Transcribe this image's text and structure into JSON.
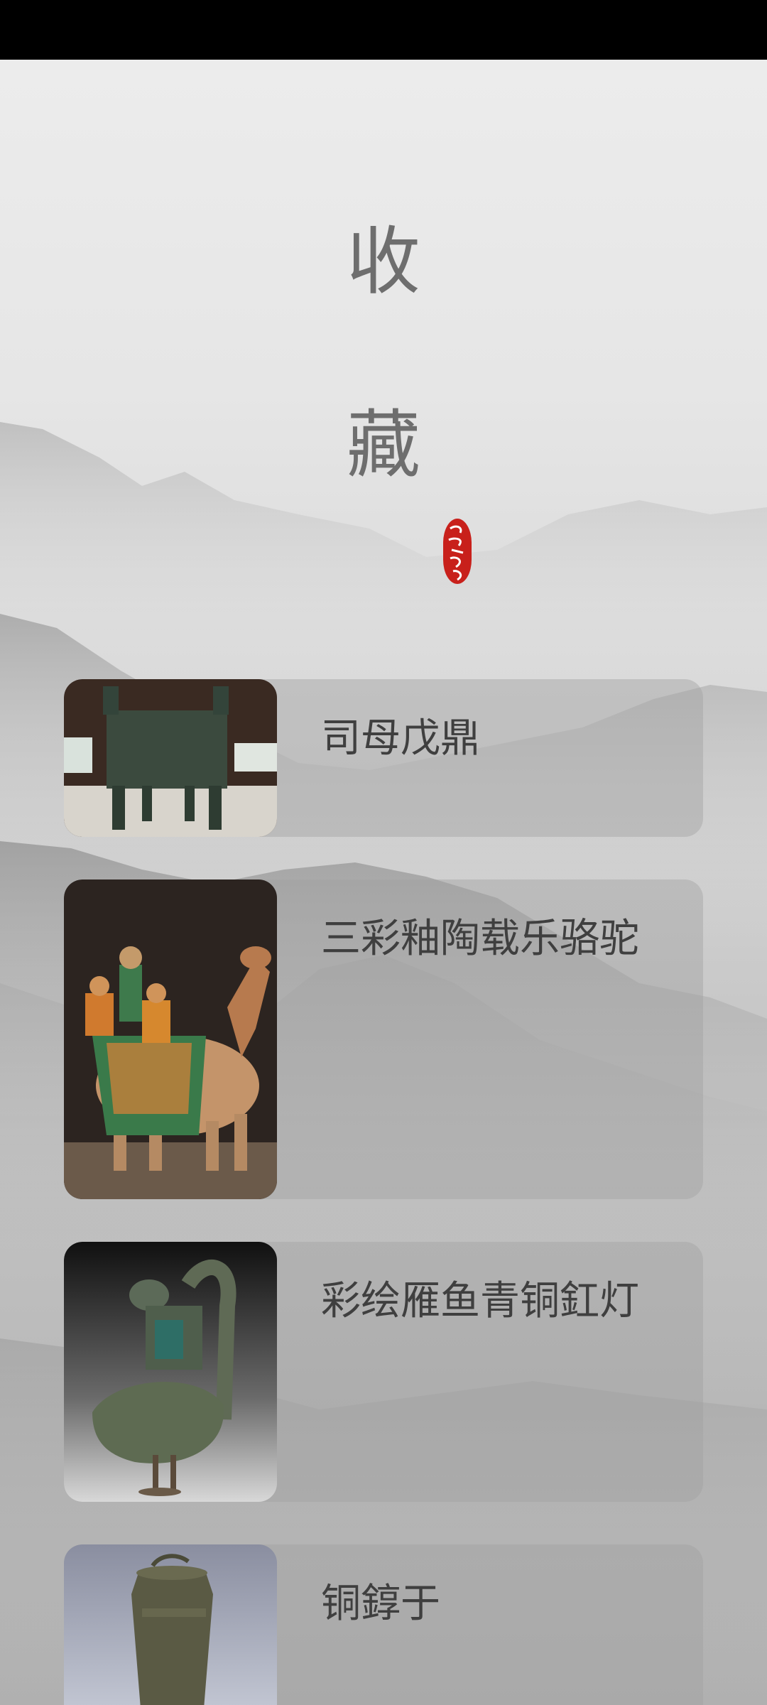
{
  "header": {
    "title_line1": "收",
    "title_line2": "藏"
  },
  "collection": {
    "items": [
      {
        "title": "司母戊鼎",
        "image": "ding-cauldron-photo"
      },
      {
        "title": "三彩釉陶载乐骆驼",
        "image": "sancai-camel-photo"
      },
      {
        "title": "彩绘雁鱼青铜釭灯",
        "image": "goose-lamp-photo"
      },
      {
        "title": "铜錞于",
        "image": "bronze-chunyu-photo"
      }
    ]
  },
  "colors": {
    "background": "#e0e0e0",
    "card": "#a9a9a9",
    "seal": "#c8201b",
    "title_text": "#6e6e6e",
    "card_text": "#3f3f3f"
  }
}
